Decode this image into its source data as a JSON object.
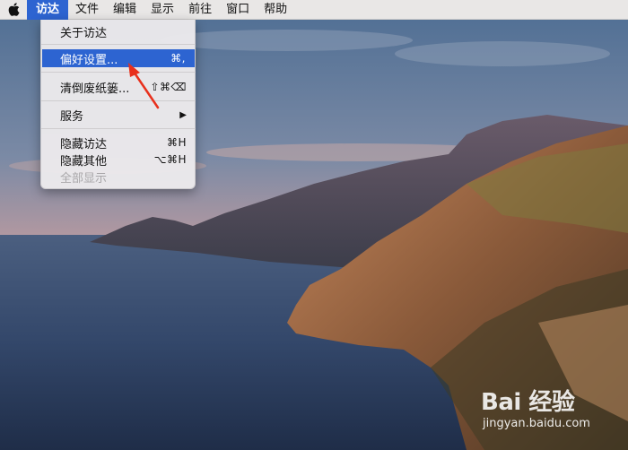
{
  "menubar": {
    "apple_icon": "apple-logo-icon",
    "items": [
      "访达",
      "文件",
      "编辑",
      "显示",
      "前往",
      "窗口",
      "帮助"
    ],
    "active_index": 0
  },
  "finder_menu": {
    "about": "关于访达",
    "preferences": "偏好设置...",
    "preferences_shortcut": "⌘,",
    "empty_trash": "清倒废纸篓...",
    "empty_trash_shortcut": "⇧⌘⌫",
    "services": "服务",
    "services_arrow": "▶",
    "hide": "隐藏访达",
    "hide_shortcut": "⌘H",
    "hide_others": "隐藏其他",
    "hide_others_shortcut": "⌥⌘H",
    "show_all": "全部显示"
  },
  "watermark": {
    "brand": "Bai 经验",
    "url": "jingyan.baidu.com"
  },
  "colors": {
    "menu_highlight": "#2d64d1",
    "arrow": "#e8301c"
  }
}
